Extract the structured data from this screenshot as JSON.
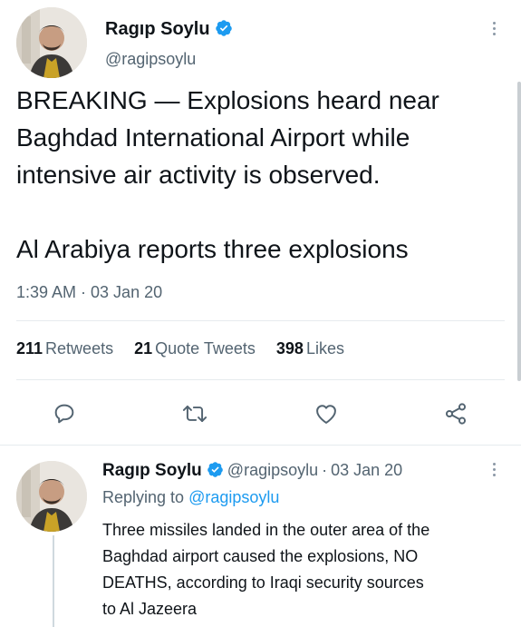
{
  "tweet": {
    "author": {
      "name": "Ragıp Soylu",
      "handle": "@ragipsoylu",
      "verified": true
    },
    "text_lines": [
      "BREAKING — Explosions heard near",
      "Baghdad International Airport while",
      "intensive air activity is observed.",
      "",
      "Al Arabiya reports three explosions"
    ],
    "timestamp": "1:39 AM · 03 Jan 20",
    "stats": [
      {
        "count": "211",
        "label": "Retweets"
      },
      {
        "count": "21",
        "label": "Quote Tweets"
      },
      {
        "count": "398",
        "label": "Likes"
      }
    ],
    "actions": [
      {
        "icon": "reply-icon"
      },
      {
        "icon": "retweet-icon"
      },
      {
        "icon": "like-icon"
      },
      {
        "icon": "share-icon"
      }
    ]
  },
  "reply": {
    "author": {
      "name": "Ragıp Soylu",
      "handle": "@ragipsoylu",
      "verified": true
    },
    "date": "03 Jan 20",
    "separator": "·",
    "replying_prefix": "Replying to",
    "replying_to": "@ragipsoylu",
    "text_lines": [
      "Three missiles landed in the outer area of the",
      "Baghdad airport caused the explosions, NO",
      "DEATHS, according to Iraqi security sources",
      "to Al Jazeera"
    ]
  },
  "colors": {
    "accent": "#1d9bf0",
    "verified": "#1d9bf0",
    "secondary_text": "#536471",
    "primary_text": "#0f1419",
    "divider": "#e6ebee"
  }
}
